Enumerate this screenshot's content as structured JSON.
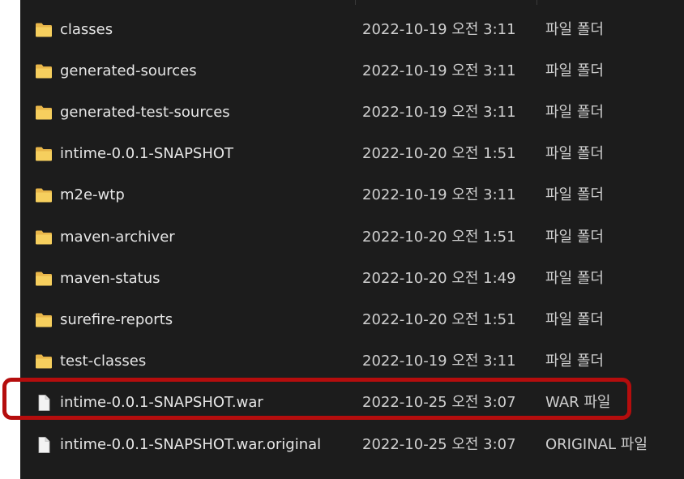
{
  "files": [
    {
      "name": "classes",
      "modified": "2022-10-19 오전 3:11",
      "type": "파일 폴더",
      "icon": "folder-icon"
    },
    {
      "name": "generated-sources",
      "modified": "2022-10-19 오전 3:11",
      "type": "파일 폴더",
      "icon": "folder-icon"
    },
    {
      "name": "generated-test-sources",
      "modified": "2022-10-19 오전 3:11",
      "type": "파일 폴더",
      "icon": "folder-icon"
    },
    {
      "name": "intime-0.0.1-SNAPSHOT",
      "modified": "2022-10-20 오전 1:51",
      "type": "파일 폴더",
      "icon": "folder-icon"
    },
    {
      "name": "m2e-wtp",
      "modified": "2022-10-19 오전 3:11",
      "type": "파일 폴더",
      "icon": "folder-icon"
    },
    {
      "name": "maven-archiver",
      "modified": "2022-10-20 오전 1:51",
      "type": "파일 폴더",
      "icon": "folder-icon"
    },
    {
      "name": "maven-status",
      "modified": "2022-10-20 오전 1:49",
      "type": "파일 폴더",
      "icon": "folder-icon"
    },
    {
      "name": "surefire-reports",
      "modified": "2022-10-20 오전 1:51",
      "type": "파일 폴더",
      "icon": "folder-icon"
    },
    {
      "name": "test-classes",
      "modified": "2022-10-19 오전 3:11",
      "type": "파일 폴더",
      "icon": "folder-icon"
    },
    {
      "name": "intime-0.0.1-SNAPSHOT.war",
      "modified": "2022-10-25 오전 3:07",
      "type": "WAR 파일",
      "icon": "file-icon"
    },
    {
      "name": "intime-0.0.1-SNAPSHOT.war.original",
      "modified": "2022-10-25 오전 3:07",
      "type": "ORIGINAL 파일",
      "icon": "file-icon"
    }
  ],
  "colors": {
    "background": "#1c1c1c",
    "folder": "#f2c94c",
    "highlight_border": "#b50d0d",
    "text": "#e6e6e6"
  }
}
